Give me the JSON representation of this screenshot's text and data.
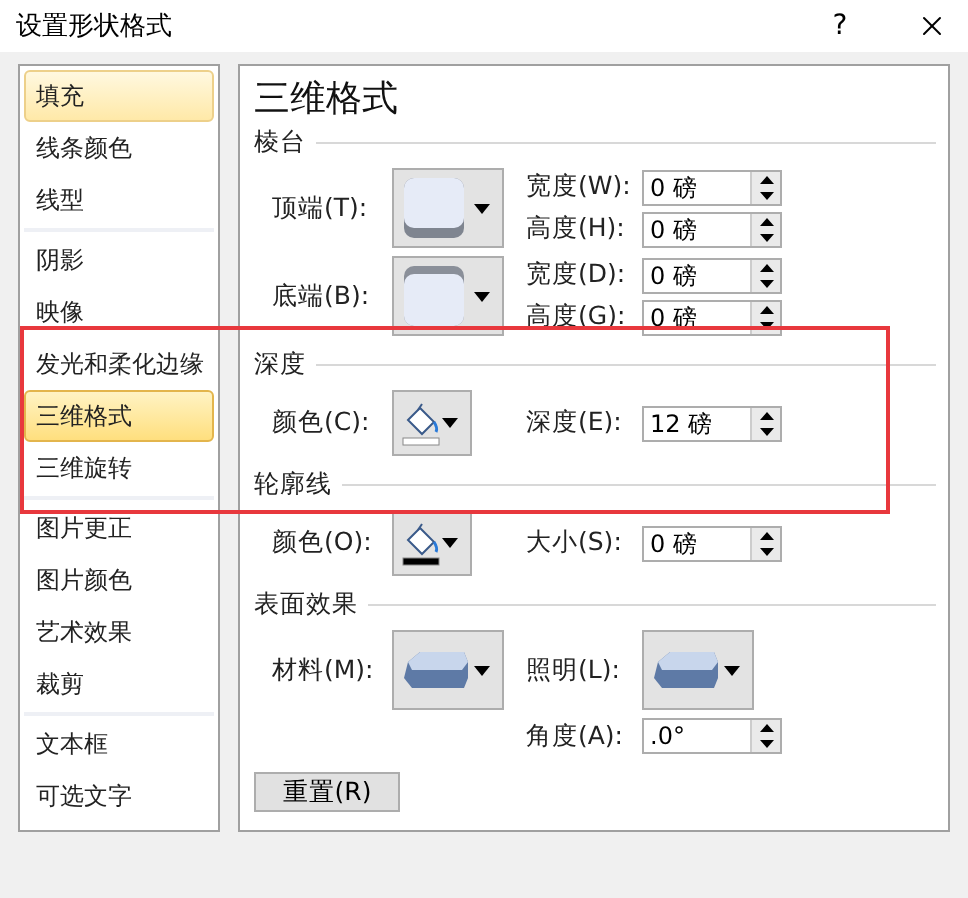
{
  "window": {
    "title": "设置形状格式",
    "help_button": "?"
  },
  "sidebar": {
    "groups": [
      {
        "items": [
          {
            "label": "填充",
            "selected": false,
            "highlighted": true
          },
          {
            "label": "线条颜色",
            "selected": false,
            "highlighted": false
          },
          {
            "label": "线型",
            "selected": false,
            "highlighted": false
          }
        ]
      },
      {
        "items": [
          {
            "label": "阴影",
            "selected": false,
            "highlighted": false
          },
          {
            "label": "映像",
            "selected": false,
            "highlighted": false
          },
          {
            "label": "发光和柔化边缘",
            "selected": false,
            "highlighted": false
          },
          {
            "label": "三维格式",
            "selected": true,
            "highlighted": false
          },
          {
            "label": "三维旋转",
            "selected": false,
            "highlighted": false
          }
        ]
      },
      {
        "items": [
          {
            "label": "图片更正",
            "selected": false,
            "highlighted": false
          },
          {
            "label": "图片颜色",
            "selected": false,
            "highlighted": false
          },
          {
            "label": "艺术效果",
            "selected": false,
            "highlighted": false
          },
          {
            "label": "裁剪",
            "selected": false,
            "highlighted": false
          }
        ]
      },
      {
        "items": [
          {
            "label": "文本框",
            "selected": false,
            "highlighted": false
          },
          {
            "label": "可选文字",
            "selected": false,
            "highlighted": false
          }
        ]
      }
    ]
  },
  "panel": {
    "heading": "三维格式",
    "sections": [
      {
        "title": "棱台",
        "rows": [
          {
            "label": "顶端(T):",
            "picker": {
              "kind": "bevel-top"
            },
            "fields": [
              {
                "label": "宽度(W):",
                "value": "0 磅"
              },
              {
                "label": "高度(H):",
                "value": "0 磅"
              }
            ]
          },
          {
            "label": "底端(B):",
            "picker": {
              "kind": "bevel-bottom"
            },
            "fields": [
              {
                "label": "宽度(D):",
                "value": "0 磅"
              },
              {
                "label": "高度(G):",
                "value": "0 磅"
              }
            ]
          }
        ]
      },
      {
        "title": "深度",
        "rows": [
          {
            "label": "颜色(C):",
            "picker": {
              "kind": "color",
              "color": "#ffffff"
            },
            "fields": [
              {
                "label": "深度(E):",
                "value": "12 磅"
              }
            ]
          }
        ]
      },
      {
        "title": "轮廓线",
        "rows": [
          {
            "label": "颜色(O):",
            "picker": {
              "kind": "color",
              "color": "#000000"
            },
            "fields": [
              {
                "label": "大小(S):",
                "value": "0 磅"
              }
            ]
          }
        ]
      },
      {
        "title": "表面效果",
        "rows": [
          {
            "label": "材料(M):",
            "picker": {
              "kind": "material"
            },
            "side": {
              "label": "照明(L):",
              "picker": {
                "kind": "lighting"
              }
            }
          },
          {
            "fields": [
              {
                "label": "角度(A):",
                "value": ".0°"
              }
            ]
          }
        ]
      }
    ],
    "reset_button": "重置(R)"
  },
  "annotations": [
    {
      "kind": "rectangle"
    }
  ]
}
